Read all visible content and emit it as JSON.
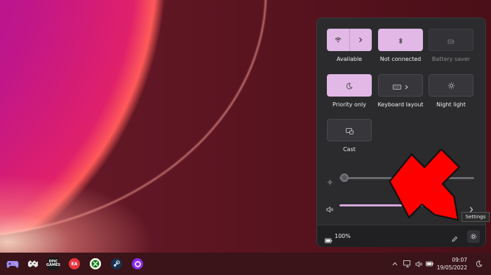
{
  "quick_settings": {
    "tiles": [
      {
        "label": "Available",
        "icon": "wifi-icon",
        "state": "on"
      },
      {
        "label": "Not connected",
        "icon": "bluetooth-icon",
        "state": "on"
      },
      {
        "label": "Battery saver",
        "icon": "battery-saver-icon",
        "state": "disabled"
      },
      {
        "label": "Priority only",
        "icon": "moon-icon",
        "state": "on"
      },
      {
        "label": "Keyboard layout",
        "icon": "keyboard-icon",
        "state": "off"
      },
      {
        "label": "Night light",
        "icon": "brightness-icon",
        "state": "off"
      },
      {
        "label": "Cast",
        "icon": "cast-icon",
        "state": "off"
      }
    ],
    "brightness_level": 0.0,
    "volume_level": 1.0,
    "battery_text": "100%",
    "tooltip": "Settings"
  },
  "taskbar": {
    "apps": [
      "gamepad-icon",
      "app-icon",
      "epic-games-icon",
      "ea-icon",
      "xbox-icon",
      "steam-icon",
      "circle-app-icon"
    ],
    "epic_label": "EPIC\nGAMES",
    "ea_label": "EA",
    "clock_time": "09:07",
    "clock_date": "19/05/2022"
  },
  "colors": {
    "tile_on": "#e2b8e6",
    "panel_bg": "#2b2b2e",
    "annotation_arrow": "#ff0000",
    "taskbar_bg": "#3a1418"
  }
}
